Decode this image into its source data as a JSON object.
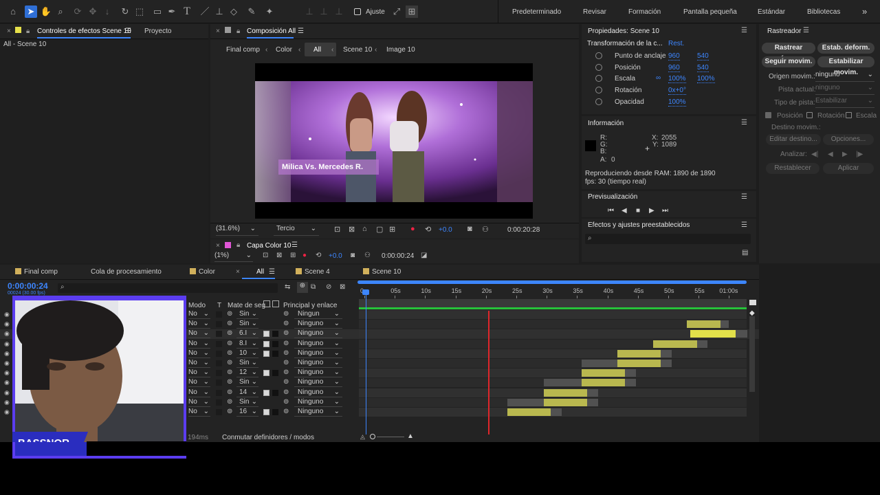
{
  "toolbar": {
    "ajuste_label": "Ajuste",
    "workspaces": [
      "Predeterminado",
      "Revisar",
      "Formación",
      "Pantalla pequeña",
      "Estándar",
      "Bibliotecas"
    ],
    "more": "»"
  },
  "effects_panel": {
    "tab_effects": "Controles de efectos Scene 10",
    "tab_project": "Proyecto",
    "subtitle": "All - Scene 10"
  },
  "composition": {
    "tab_title": "Composición All",
    "breadcrumbs": [
      "Final comp",
      "Color",
      "All",
      "Scene 10",
      "Image 10"
    ],
    "zoom": "(31.6%)",
    "resolution": "Tercio",
    "exposure": "+0.0",
    "timecode": "0:00:20:28",
    "overlay_text": "Milica Vs. Mercedes R."
  },
  "layer_panel": {
    "tab_title": "Capa Color 10",
    "zoom": "(1%)",
    "exposure": "+0.0",
    "timecode": "0:00:00:24"
  },
  "properties": {
    "title": "Propiedades: Scene 10",
    "section": "Transformación de la c...",
    "reset": "Rest.",
    "rows": [
      {
        "label": "Punto de anclaje",
        "v1": "960",
        "v2": "540"
      },
      {
        "label": "Posición",
        "v1": "960",
        "v2": "540"
      },
      {
        "label": "Escala",
        "v1": "100%",
        "v2": "100%"
      },
      {
        "label": "Rotación",
        "v1": "0x+0°",
        "v2": ""
      },
      {
        "label": "Opacidad",
        "v1": "100%",
        "v2": ""
      }
    ]
  },
  "info": {
    "title": "Información",
    "r": "R:",
    "g": "G:",
    "b": "B:",
    "a": "A:",
    "a_val": "0",
    "x": "X:",
    "x_val": "2055",
    "y": "Y:",
    "y_val": "1089",
    "ram": "Reproduciendo desde RAM: 1890 de 1890",
    "fps": "fps: 30 (tiempo real)"
  },
  "preview": {
    "title": "Previsualización"
  },
  "effects_presets": {
    "title": "Efectos y ajustes preestablecidos",
    "search_placeholder": ""
  },
  "tracker": {
    "title": "Rastreador",
    "btn_camera": "Rastrear cámara",
    "btn_warp": "Estab. deform.",
    "btn_track": "Seguir movim.",
    "btn_stabilize": "Estabilizar movim.",
    "origin_label": "Origen movim.:",
    "origin_value": "ninguno",
    "current_label": "Pista actual:",
    "current_value": "ninguno",
    "type_label": "Tipo de pista:",
    "type_value": "Estabilizar",
    "chk_position": "Posición",
    "chk_rotation": "Rotación",
    "chk_scale": "Escala",
    "target_label": "Destino movim.:",
    "btn_edit_target": "Editar destino...",
    "btn_options": "Opciones...",
    "analyze_label": "Analizar:",
    "btn_reset": "Restablecer",
    "btn_apply": "Aplicar"
  },
  "timeline": {
    "tabs": [
      {
        "label": "Final comp",
        "color": "#d1b05b"
      },
      {
        "label": "Cola de procesamiento",
        "color": ""
      },
      {
        "label": "Color",
        "color": "#d1b05b"
      },
      {
        "label": "All",
        "color": ""
      },
      {
        "label": "Scene 4",
        "color": "#d1b05b"
      },
      {
        "label": "Scene 10",
        "color": "#d1b05b"
      }
    ],
    "timecode": "0:00:00:24",
    "frame_info": "00024 (30.00 fps)",
    "col_mode": "Modo",
    "col_t": "T",
    "col_matte": "Mate de seg...",
    "col_parent": "Principal y enlace",
    "ruler": [
      "0s",
      "05s",
      "10s",
      "15s",
      "20s",
      "25s",
      "30s",
      "35s",
      "40s",
      "45s",
      "50s",
      "55s",
      "01:00s"
    ],
    "footer_ms": "194ms",
    "footer_toggle": "Conmutar definidores / modos",
    "layers": [
      {
        "mode": "No",
        "matte": "Sin",
        "parent": "Ningun"
      },
      {
        "mode": "No",
        "matte": "Sin",
        "parent": "Ninguno"
      },
      {
        "mode": "No",
        "matte": "6.I",
        "parent": "Ninguno"
      },
      {
        "mode": "No",
        "matte": "8.I",
        "parent": "Ninguno"
      },
      {
        "mode": "No",
        "matte": "10",
        "parent": "Ninguno"
      },
      {
        "mode": "No",
        "matte": "Sin",
        "parent": "Ninguno"
      },
      {
        "mode": "No",
        "matte": "12",
        "parent": "Ninguno"
      },
      {
        "mode": "No",
        "matte": "Sin",
        "parent": "Ninguno"
      },
      {
        "mode": "No",
        "matte": "14",
        "parent": "Ninguno"
      },
      {
        "mode": "No",
        "matte": "Sin",
        "parent": "Ninguno"
      },
      {
        "mode": "No",
        "matte": "16",
        "parent": "Ninguno"
      }
    ]
  },
  "webcam": {
    "name": "BASSNOR"
  },
  "colors": {
    "accent": "#3d86ff",
    "track_yellow": "#b9b84f",
    "track_gray": "#515151",
    "playhead": "#e0262b",
    "work_area": "#27c33a"
  }
}
